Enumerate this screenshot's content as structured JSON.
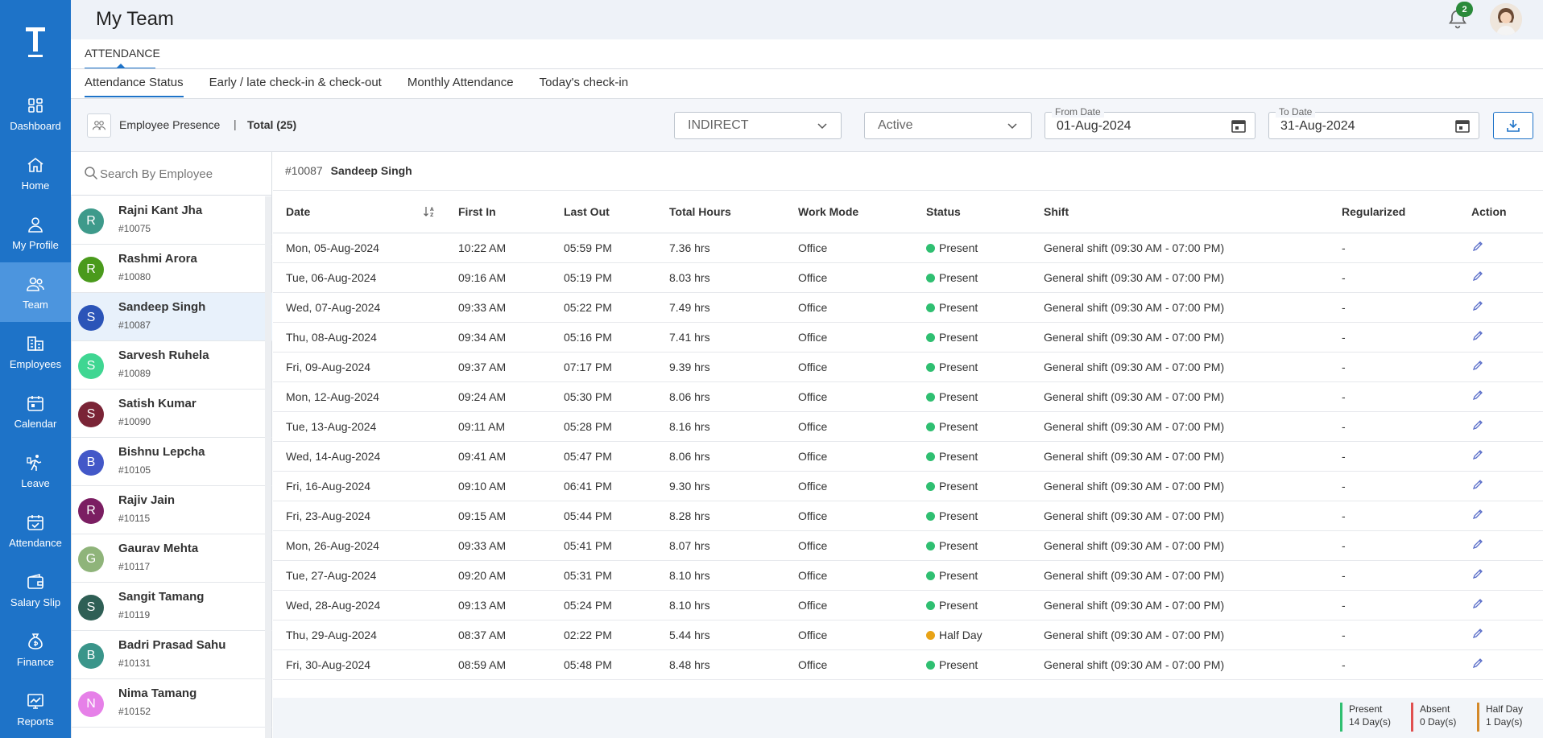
{
  "sidebar": {
    "logo_letter": "T",
    "items": [
      {
        "label": "Dashboard",
        "icon": "dashboard-icon",
        "active": false
      },
      {
        "label": "Home",
        "icon": "home-icon",
        "active": false
      },
      {
        "label": "My Profile",
        "icon": "user-icon",
        "active": false
      },
      {
        "label": "Team",
        "icon": "team-icon",
        "active": true
      },
      {
        "label": "Employees",
        "icon": "building-icon",
        "active": false
      },
      {
        "label": "Calendar",
        "icon": "calendar-icon",
        "active": false
      },
      {
        "label": "Leave",
        "icon": "running-person-icon",
        "active": false
      },
      {
        "label": "Attendance",
        "icon": "calendar-check-icon",
        "active": false
      },
      {
        "label": "Salary Slip",
        "icon": "wallet-icon",
        "active": false
      },
      {
        "label": "Finance",
        "icon": "money-bag-icon",
        "active": false
      },
      {
        "label": "Reports",
        "icon": "chart-icon",
        "active": false
      }
    ]
  },
  "header": {
    "title": "My Team",
    "notification_count": "2"
  },
  "section_tab": "ATTENDANCE",
  "subtabs": [
    "Attendance Status",
    "Early / late check-in & check-out",
    "Monthly Attendance",
    "Today's check-in"
  ],
  "filters": {
    "presence_label": "Employee Presence",
    "separator": "|",
    "total_label": "Total (25)",
    "type_value": "INDIRECT",
    "status_value": "Active",
    "from_date_label": "From Date",
    "from_date_value": "01-Aug-2024",
    "to_date_label": "To Date",
    "to_date_value": "31-Aug-2024"
  },
  "search": {
    "placeholder": "Search By Employee"
  },
  "employees": [
    {
      "initial": "R",
      "name": "Rajni Kant Jha",
      "id": "#10075",
      "color": "#3e9a8b"
    },
    {
      "initial": "R",
      "name": "Rashmi Arora",
      "id": "#10080",
      "color": "#4a9a1c"
    },
    {
      "initial": "S",
      "name": "Sandeep Singh",
      "id": "#10087",
      "color": "#2b54b8"
    },
    {
      "initial": "S",
      "name": "Sarvesh Ruhela",
      "id": "#10089",
      "color": "#3fd692"
    },
    {
      "initial": "S",
      "name": "Satish Kumar",
      "id": "#10090",
      "color": "#7a2436"
    },
    {
      "initial": "B",
      "name": "Bishnu Lepcha",
      "id": "#10105",
      "color": "#4358c8"
    },
    {
      "initial": "R",
      "name": "Rajiv Jain",
      "id": "#10115",
      "color": "#7b1e62"
    },
    {
      "initial": "G",
      "name": "Gaurav Mehta",
      "id": "#10117",
      "color": "#8fb47a"
    },
    {
      "initial": "S",
      "name": "Sangit Tamang",
      "id": "#10119",
      "color": "#2f5f55"
    },
    {
      "initial": "B",
      "name": "Badri Prasad Sahu",
      "id": "#10131",
      "color": "#3a958a"
    },
    {
      "initial": "N",
      "name": "Nima Tamang",
      "id": "#10152",
      "color": "#e680e8"
    }
  ],
  "selected_employee": {
    "id": "#10087",
    "name": "Sandeep Singh"
  },
  "table": {
    "headers": [
      "Date",
      "First In",
      "Last Out",
      "Total Hours",
      "Work Mode",
      "Status",
      "Shift",
      "Regularized",
      "Action"
    ],
    "rows": [
      {
        "date": "Mon, 05-Aug-2024",
        "first_in": "10:22 AM",
        "last_out": "05:59 PM",
        "hours": "7.36 hrs",
        "mode": "Office",
        "status": "Present",
        "shift": "General shift (09:30 AM - 07:00 PM)",
        "regularized": "-"
      },
      {
        "date": "Tue, 06-Aug-2024",
        "first_in": "09:16 AM",
        "last_out": "05:19 PM",
        "hours": "8.03 hrs",
        "mode": "Office",
        "status": "Present",
        "shift": "General shift (09:30 AM - 07:00 PM)",
        "regularized": "-"
      },
      {
        "date": "Wed, 07-Aug-2024",
        "first_in": "09:33 AM",
        "last_out": "05:22 PM",
        "hours": "7.49 hrs",
        "mode": "Office",
        "status": "Present",
        "shift": "General shift (09:30 AM - 07:00 PM)",
        "regularized": "-"
      },
      {
        "date": "Thu, 08-Aug-2024",
        "first_in": "09:34 AM",
        "last_out": "05:16 PM",
        "hours": "7.41 hrs",
        "mode": "Office",
        "status": "Present",
        "shift": "General shift (09:30 AM - 07:00 PM)",
        "regularized": "-"
      },
      {
        "date": "Fri, 09-Aug-2024",
        "first_in": "09:37 AM",
        "last_out": "07:17 PM",
        "hours": "9.39 hrs",
        "mode": "Office",
        "status": "Present",
        "shift": "General shift (09:30 AM - 07:00 PM)",
        "regularized": "-"
      },
      {
        "date": "Mon, 12-Aug-2024",
        "first_in": "09:24 AM",
        "last_out": "05:30 PM",
        "hours": "8.06 hrs",
        "mode": "Office",
        "status": "Present",
        "shift": "General shift (09:30 AM - 07:00 PM)",
        "regularized": "-"
      },
      {
        "date": "Tue, 13-Aug-2024",
        "first_in": "09:11 AM",
        "last_out": "05:28 PM",
        "hours": "8.16 hrs",
        "mode": "Office",
        "status": "Present",
        "shift": "General shift (09:30 AM - 07:00 PM)",
        "regularized": "-"
      },
      {
        "date": "Wed, 14-Aug-2024",
        "first_in": "09:41 AM",
        "last_out": "05:47 PM",
        "hours": "8.06 hrs",
        "mode": "Office",
        "status": "Present",
        "shift": "General shift (09:30 AM - 07:00 PM)",
        "regularized": "-"
      },
      {
        "date": "Fri, 16-Aug-2024",
        "first_in": "09:10 AM",
        "last_out": "06:41 PM",
        "hours": "9.30 hrs",
        "mode": "Office",
        "status": "Present",
        "shift": "General shift (09:30 AM - 07:00 PM)",
        "regularized": "-"
      },
      {
        "date": "Fri, 23-Aug-2024",
        "first_in": "09:15 AM",
        "last_out": "05:44 PM",
        "hours": "8.28 hrs",
        "mode": "Office",
        "status": "Present",
        "shift": "General shift (09:30 AM - 07:00 PM)",
        "regularized": "-"
      },
      {
        "date": "Mon, 26-Aug-2024",
        "first_in": "09:33 AM",
        "last_out": "05:41 PM",
        "hours": "8.07 hrs",
        "mode": "Office",
        "status": "Present",
        "shift": "General shift (09:30 AM - 07:00 PM)",
        "regularized": "-"
      },
      {
        "date": "Tue, 27-Aug-2024",
        "first_in": "09:20 AM",
        "last_out": "05:31 PM",
        "hours": "8.10 hrs",
        "mode": "Office",
        "status": "Present",
        "shift": "General shift (09:30 AM - 07:00 PM)",
        "regularized": "-"
      },
      {
        "date": "Wed, 28-Aug-2024",
        "first_in": "09:13 AM",
        "last_out": "05:24 PM",
        "hours": "8.10 hrs",
        "mode": "Office",
        "status": "Present",
        "shift": "General shift (09:30 AM - 07:00 PM)",
        "regularized": "-"
      },
      {
        "date": "Thu, 29-Aug-2024",
        "first_in": "08:37 AM",
        "last_out": "02:22 PM",
        "hours": "5.44 hrs",
        "mode": "Office",
        "status": "Half Day",
        "shift": "General shift (09:30 AM - 07:00 PM)",
        "regularized": "-"
      },
      {
        "date": "Fri, 30-Aug-2024",
        "first_in": "08:59 AM",
        "last_out": "05:48 PM",
        "hours": "8.48 hrs",
        "mode": "Office",
        "status": "Present",
        "shift": "General shift (09:30 AM - 07:00 PM)",
        "regularized": "-"
      }
    ]
  },
  "status_colors": {
    "Present": "#2fbf71",
    "Absent": "#e05050",
    "Half Day": "#e8a317"
  },
  "legend": [
    {
      "label": "Present",
      "count": "14 Day(s)",
      "color": "#2fbf71"
    },
    {
      "label": "Absent",
      "count": "0 Day(s)",
      "color": "#e05050"
    },
    {
      "label": "Half Day",
      "count": "1 Day(s)",
      "color": "#d4892a"
    }
  ]
}
